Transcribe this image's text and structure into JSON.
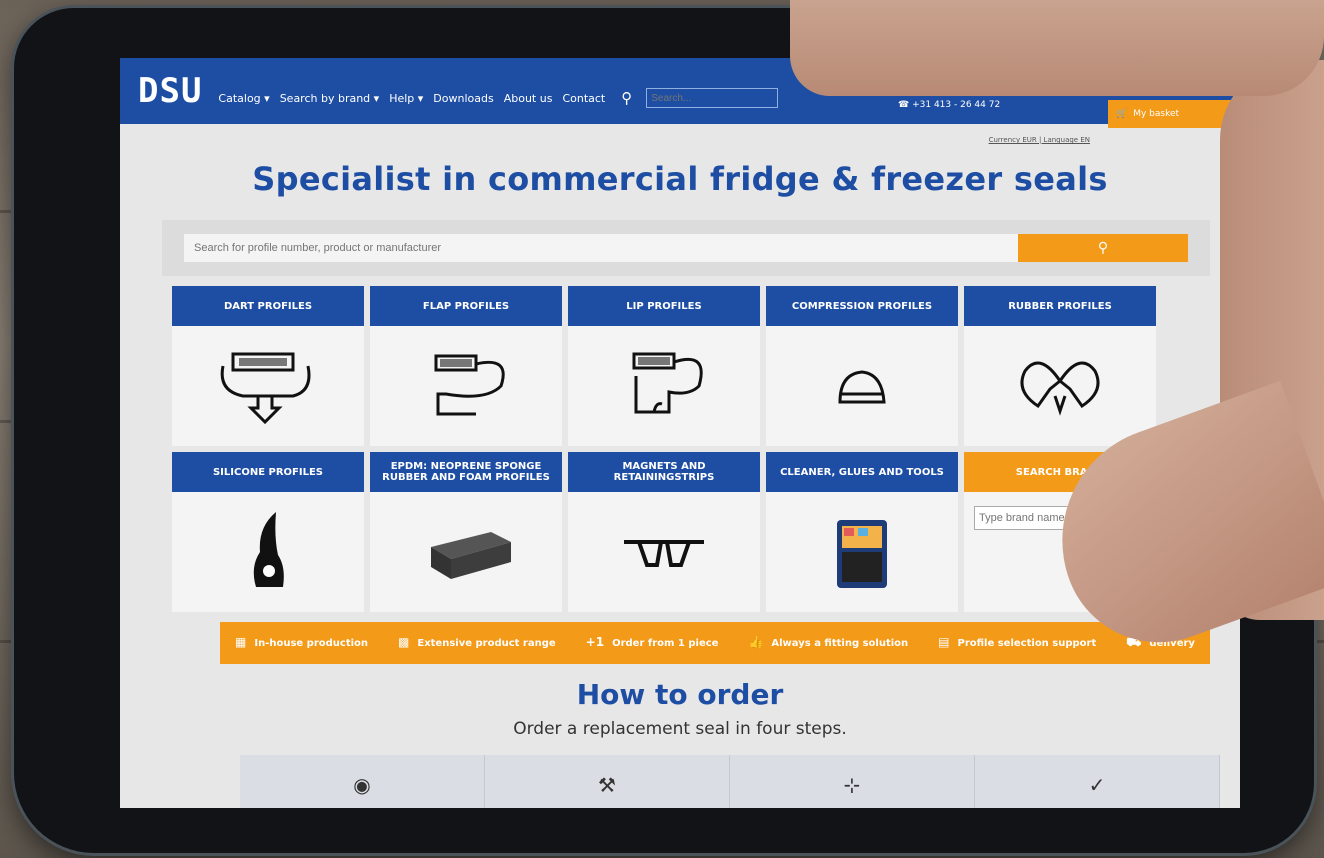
{
  "header": {
    "logo": "DSU",
    "nav": [
      "Catalog ▾",
      "Search by brand ▾",
      "Help ▾",
      "Downloads",
      "About us",
      "Contact"
    ],
    "search_placeholder": "Search...",
    "phone": "+31 413 - 26 44 72",
    "basket": "My basket",
    "sublinks": "Currency EUR | Language EN"
  },
  "hero": {
    "title": "Specialist in commercial fridge & freezer seals",
    "search_placeholder": "Search for profile number, product or manufacturer"
  },
  "categories": [
    {
      "label": "DART PROFILES"
    },
    {
      "label": "FLAP PROFILES"
    },
    {
      "label": "LIP PROFILES"
    },
    {
      "label": "COMPRESSION PROFILES"
    },
    {
      "label": "RUBBER PROFILES"
    },
    {
      "label": "SILICONE PROFILES"
    },
    {
      "label": "EPDM: NEOPRENE SPONGE RUBBER AND FOAM PROFILES"
    },
    {
      "label": "MAGNETS AND RETAININGSTRIPS"
    },
    {
      "label": "CLEANER, GLUES AND TOOLS"
    }
  ],
  "brand_search": {
    "label": "SEARCH BRAND",
    "placeholder": "Type brand name"
  },
  "usps": [
    {
      "icon": "factory-icon",
      "text": "In-house production"
    },
    {
      "icon": "grid-icon",
      "text": "Extensive product range"
    },
    {
      "icon": "plus-one-icon",
      "text": "Order from 1 piece"
    },
    {
      "icon": "thumbs-up-icon",
      "text": "Always a fitting solution"
    },
    {
      "icon": "chat-icon",
      "text": "Profile selection support"
    },
    {
      "icon": "truck-icon",
      "text": "delivery"
    }
  ],
  "order": {
    "title": "How to order",
    "subtitle": "Order a replacement seal in four steps."
  },
  "colors": {
    "brand_blue": "#1d4ea3",
    "accent_orange": "#f39a18"
  }
}
